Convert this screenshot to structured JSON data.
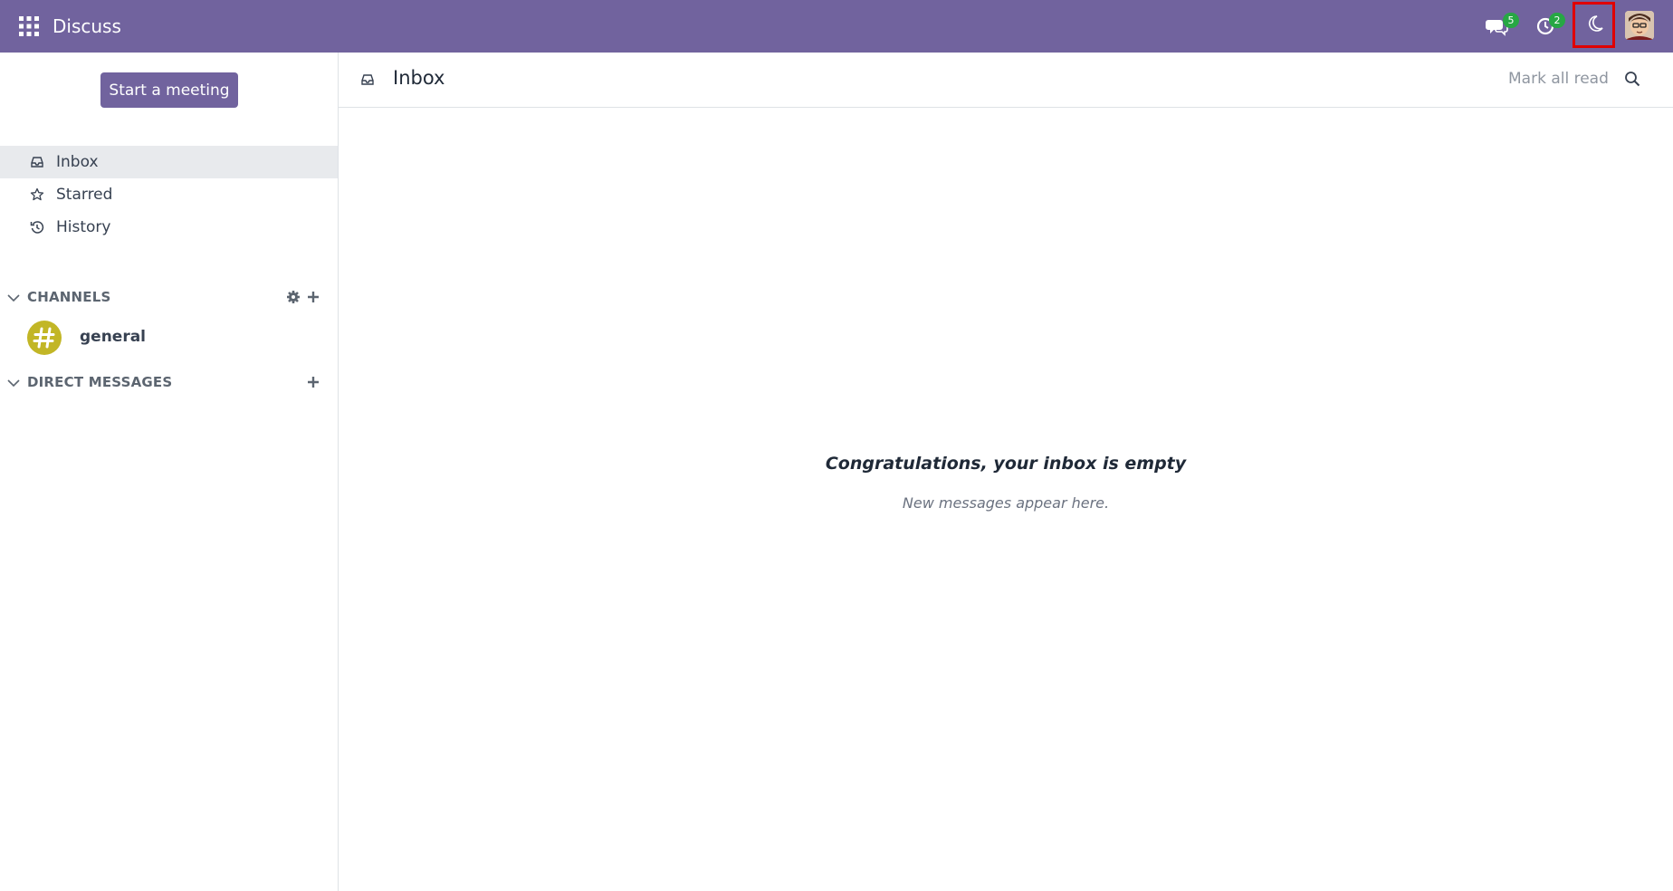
{
  "navbar": {
    "app_name": "Discuss",
    "messages_badge": "5",
    "activity_badge": "2",
    "color": "#71639e"
  },
  "sidebar": {
    "start_meeting_label": "Start a meeting",
    "mailboxes": [
      {
        "label": "Inbox",
        "icon": "inbox-icon",
        "active": true
      },
      {
        "label": "Starred",
        "icon": "star-icon",
        "active": false
      },
      {
        "label": "History",
        "icon": "history-icon",
        "active": false
      }
    ],
    "channels_label": "CHANNELS",
    "channels": [
      {
        "name": "general",
        "icon": "hashtag-icon",
        "color": "#c2b626"
      }
    ],
    "direct_messages_label": "DIRECT MESSAGES"
  },
  "thread": {
    "title": "Inbox",
    "mark_all_read_label": "Mark all read"
  },
  "empty_state": {
    "title": "Congratulations, your inbox is empty",
    "subtitle": "New messages appear here."
  }
}
